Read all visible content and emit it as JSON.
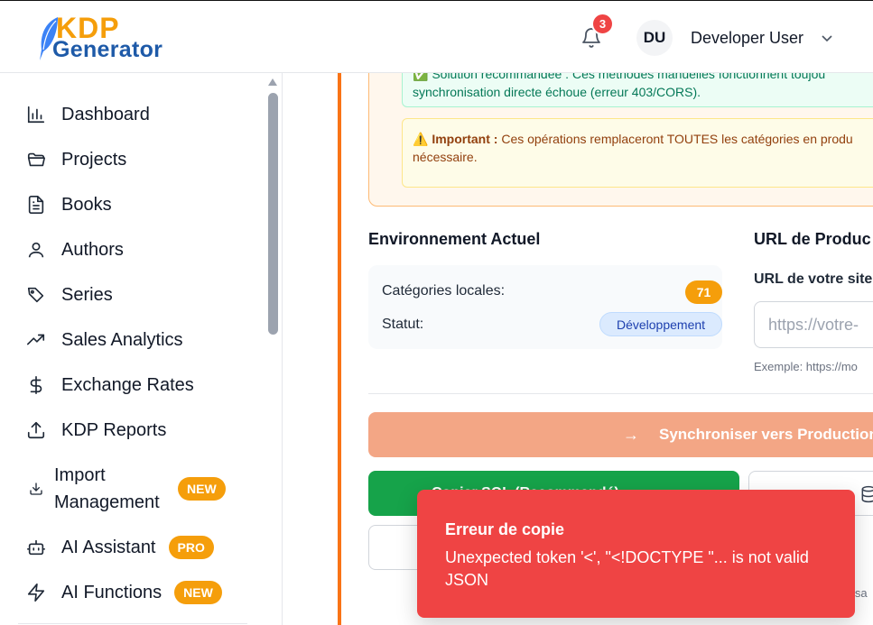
{
  "header": {
    "logo_top": "KDP",
    "logo_bottom": "Generator",
    "notification_count": "3",
    "user_initials": "DU",
    "user_name": "Developer User"
  },
  "sidebar": {
    "items": [
      {
        "label": "Dashboard",
        "icon": "bar-chart-icon"
      },
      {
        "label": "Projects",
        "icon": "folder-icon"
      },
      {
        "label": "Books",
        "icon": "document-icon"
      },
      {
        "label": "Authors",
        "icon": "user-icon"
      },
      {
        "label": "Series",
        "icon": "tags-icon"
      },
      {
        "label": "Sales Analytics",
        "icon": "trending-up-icon"
      },
      {
        "label": "Exchange Rates",
        "icon": "dollar-icon"
      },
      {
        "label": "KDP Reports",
        "icon": "upload-icon"
      },
      {
        "label": "Import\nManagement",
        "icon": "download-icon",
        "badge": "NEW"
      },
      {
        "label": "AI Assistant",
        "icon": "bot-icon",
        "badge": "PRO"
      },
      {
        "label": "AI Functions",
        "icon": "zap-icon",
        "badge": "NEW"
      }
    ]
  },
  "main": {
    "green_note": "✅ Solution recommandée : Ces méthodes manuelles fonctionnent toujou",
    "green_note_line2": "synchronisation directe échoue (erreur 403/CORS).",
    "yellow_note_bold": "Important :",
    "yellow_note_text": "Ces opérations remplaceront TOUTES les catégories en produ",
    "yellow_note_line2": "nécessaire.",
    "env_title": "Environnement Actuel",
    "env_local_label": "Catégories locales:",
    "env_local_count": "71",
    "env_status_label": "Statut:",
    "env_status_value": "Développement",
    "url_title": "URL de Produc",
    "url_label": "URL de votre site",
    "url_placeholder": "https://votre-",
    "url_example": "Exemple: https://mo",
    "sync_button": "Synchroniser vers Production",
    "green_button": "Copier SQL (Recommandé)",
    "partial_text": "isa"
  },
  "toast": {
    "title": "Erreur de copie",
    "message": "Unexpected token '<', \"<!DOCTYPE \"... is not valid JSON"
  },
  "colors": {
    "accent_orange": "#f59e0b",
    "brand_blue": "#1e5aa8",
    "danger": "#ef4444",
    "success": "#16a34a"
  }
}
